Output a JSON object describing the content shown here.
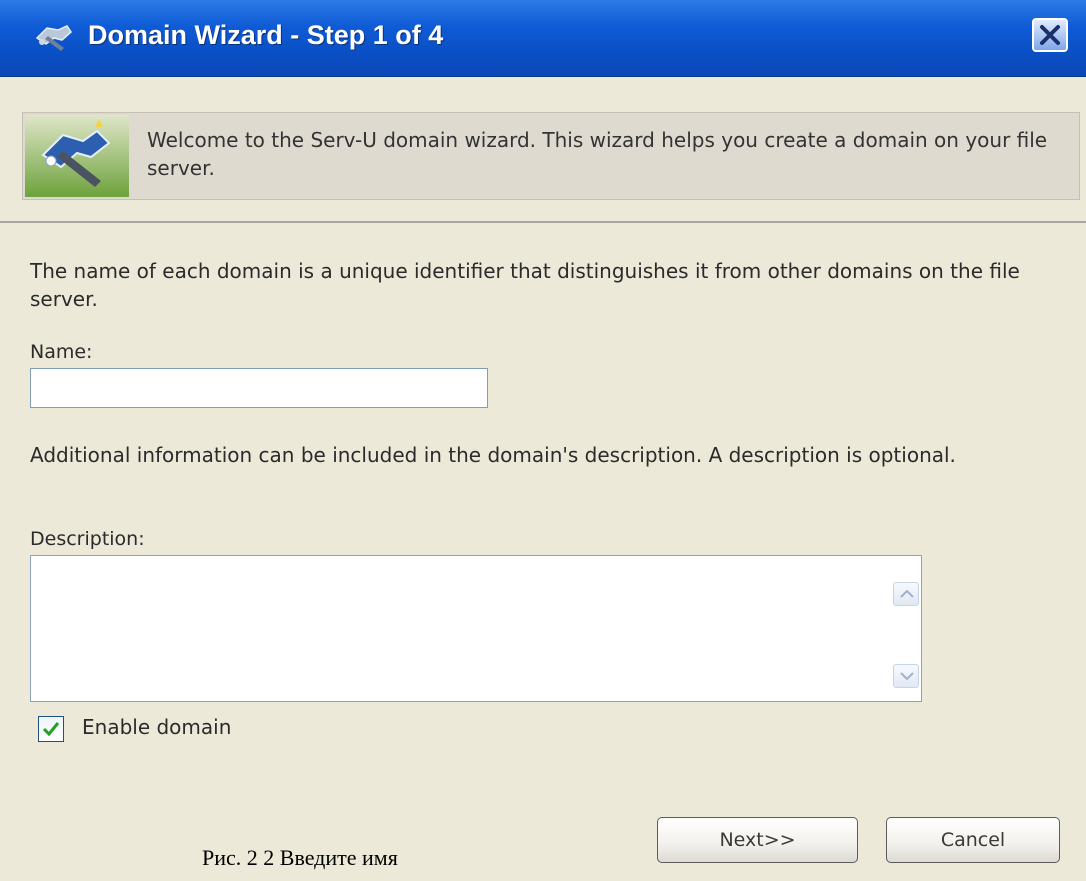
{
  "window": {
    "title": "Domain Wizard - Step 1 of 4",
    "title_icon": "wizard-icon",
    "close_icon": "close-icon"
  },
  "banner": {
    "icon": "wizard-banner-icon",
    "text": "Welcome to the Serv-U domain wizard. This wizard helps you create a domain on your file server."
  },
  "form": {
    "name_intro": "The name of each domain is a unique identifier that distinguishes it from other domains on the file server.",
    "name_label": "Name:",
    "name_value": "",
    "description_intro": "Additional information can be included in the domain's description. A description is optional.",
    "description_label": "Description:",
    "description_value": "",
    "enable_label": "Enable domain",
    "enable_checked": true
  },
  "buttons": {
    "next": "Next>>",
    "cancel": "Cancel"
  },
  "caption": "Рис. 2 2 Введите имя",
  "colors": {
    "titlebar": "#0f5bd6",
    "dialog_bg": "#ece9d8",
    "banner_bg": "#dedad0"
  }
}
